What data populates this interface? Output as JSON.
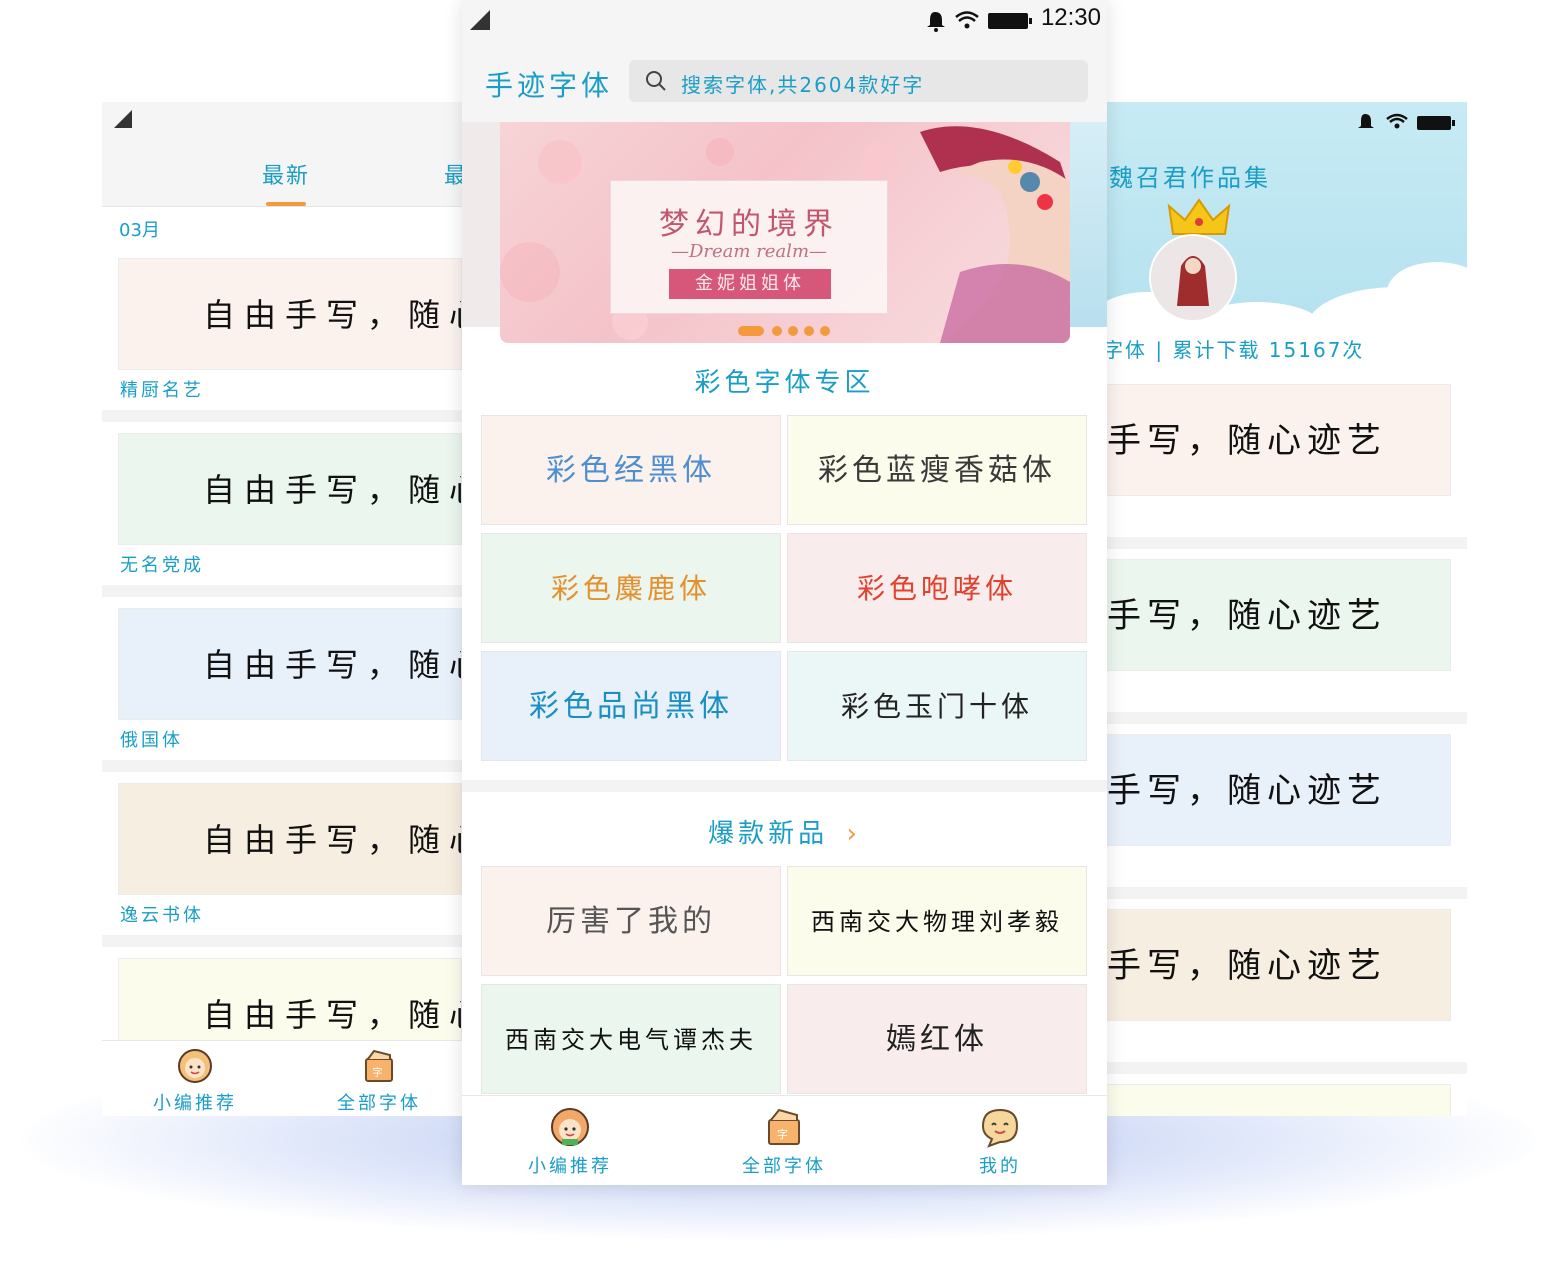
{
  "left": {
    "tabs": [
      "最新",
      "最"
    ],
    "month": "03月",
    "cards": [
      {
        "sample": "自由手写，随心",
        "name": "精厨名艺",
        "bg": "#fbf2ee"
      },
      {
        "sample": "自由手写，随心",
        "name": "无名党成",
        "bg": "#eaf6ee"
      },
      {
        "sample": "自由手写，随心",
        "name": "俄国体",
        "bg": "#e8f0fa"
      },
      {
        "sample": "自由手写，随心",
        "name": "逸云书体",
        "bg": "#f6eee0"
      },
      {
        "sample": "自由手写，随心",
        "name": "",
        "bg": "#fcfcec"
      }
    ],
    "nav": [
      "小编推荐",
      "全部字体"
    ]
  },
  "center": {
    "status_time": "12:30",
    "app_title": "手迹字体",
    "search_placeholder": "搜索字体,共2604款好字",
    "banner": {
      "title": "梦幻的境界",
      "subtitle": "—Dream realm—",
      "tag": "金妮姐姐体"
    },
    "color_section_title": "彩色字体专区",
    "color_fonts": [
      {
        "label": "彩色经黑体",
        "bg": "#fbf2ee",
        "color": "#4e8fcf",
        "size": 30
      },
      {
        "label": "彩色蓝瘦香菇体",
        "bg": "#fcfcec",
        "color": "#3a3a3a",
        "size": 30
      },
      {
        "label": "彩色麋鹿体",
        "bg": "#eaf6ee",
        "color": "#e58f2d",
        "size": 28
      },
      {
        "label": "彩色咆哮体",
        "bg": "#f8ecec",
        "color": "#e0422e",
        "size": 28
      },
      {
        "label": "彩色品尚黑体",
        "bg": "#e8f0fa",
        "color": "#1a8fc4",
        "size": 30
      },
      {
        "label": "彩色玉门十体",
        "bg": "#ebf6f6",
        "color": "#222222",
        "size": 28
      }
    ],
    "new_section_title": "爆款新品",
    "new_section_arrow": "›",
    "new_fonts": [
      {
        "label": "厉害了我的",
        "bg": "#fbf2ee",
        "color": "#555555",
        "size": 30
      },
      {
        "label": "西南交大物理刘孝毅",
        "bg": "#fcfcec",
        "color": "#111111",
        "size": 24
      },
      {
        "label": "西南交大电气谭杰夫",
        "bg": "#eaf6ee",
        "color": "#111111",
        "size": 24
      },
      {
        "label": "嫣红体",
        "bg": "#f8ecec",
        "color": "#222222",
        "size": 30
      }
    ],
    "nav": [
      "小编推荐",
      "全部字体",
      "我的"
    ]
  },
  "right": {
    "title": "魏召君作品集",
    "stats": "字体 | 累计下载 15167次",
    "cards": [
      {
        "sample": "手写，随心迹艺",
        "bg": "#fbf2ee"
      },
      {
        "sample": "手写，随心迹艺",
        "bg": "#eaf6ee"
      },
      {
        "sample": "手写，随心迹艺",
        "bg": "#e8f0fa"
      },
      {
        "sample": "手写，随心迹艺",
        "bg": "#f6eee0"
      },
      {
        "sample": "",
        "bg": "#fcfcec"
      }
    ]
  },
  "accent_color": "#1a9ec7",
  "highlight_color": "#f39a3d"
}
